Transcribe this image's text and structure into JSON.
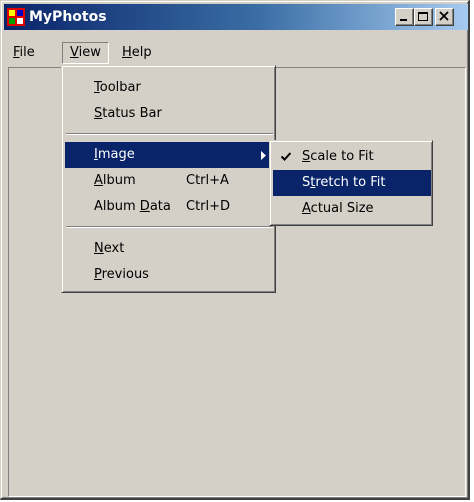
{
  "window": {
    "title": "MyPhotos",
    "icon": "app-icon"
  },
  "menubar": {
    "items": [
      {
        "label": "File",
        "mnemonic": "F"
      },
      {
        "label": "View",
        "mnemonic": "V"
      },
      {
        "label": "Help",
        "mnemonic": "H"
      }
    ]
  },
  "view_menu": {
    "items": [
      {
        "label": "Toolbar",
        "mnemonic": "T",
        "shortcut": ""
      },
      {
        "label": "Status Bar",
        "mnemonic": "S",
        "shortcut": ""
      },
      {
        "label": "Image",
        "mnemonic": "I",
        "shortcut": "",
        "has_submenu": true,
        "highlighted": true
      },
      {
        "label": "Album",
        "mnemonic": "A",
        "shortcut": "Ctrl+A"
      },
      {
        "label": "Album Data",
        "mnemonic": "D",
        "shortcut": "Ctrl+D"
      },
      {
        "label": "Next",
        "mnemonic": "N",
        "shortcut": ""
      },
      {
        "label": "Previous",
        "mnemonic": "P",
        "shortcut": ""
      }
    ]
  },
  "image_menu": {
    "items": [
      {
        "label": "Scale to Fit",
        "mnemonic": "S",
        "checked": true
      },
      {
        "label": "Stretch to Fit",
        "mnemonic": "t",
        "highlighted": true
      },
      {
        "label": "Actual Size",
        "mnemonic": "A"
      }
    ]
  },
  "colors": {
    "title_gradient_start": "#0a246a",
    "title_gradient_end": "#a6caf0",
    "face": "#d4d0c8",
    "highlight": "#0a246a"
  }
}
